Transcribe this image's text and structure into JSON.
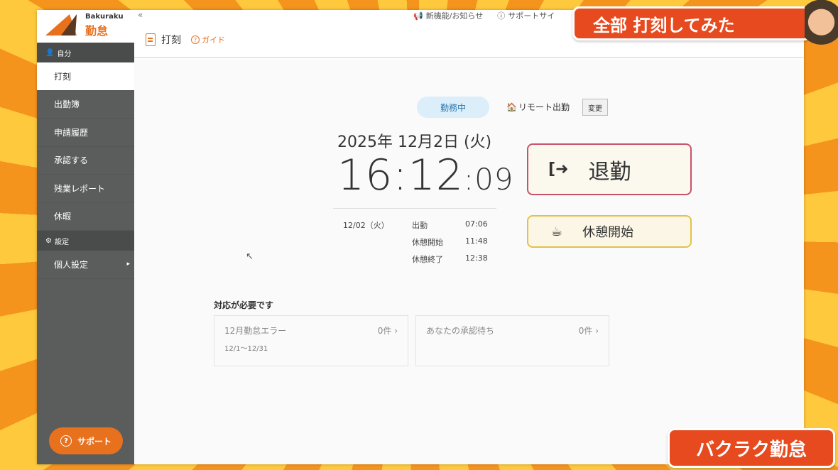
{
  "overlay": {
    "banner": "全部 打刻してみた",
    "brand_tag": "バクラク勤怠"
  },
  "logo": {
    "en": "Bakuraku",
    "jp": "勤怠"
  },
  "sidebar": {
    "section_self": "自分",
    "items": [
      {
        "label": "打刻"
      },
      {
        "label": "出勤簿"
      },
      {
        "label": "申請履歴"
      },
      {
        "label": "承認する"
      },
      {
        "label": "残業レポート"
      },
      {
        "label": "休暇"
      }
    ],
    "section_settings": "設定",
    "personal_settings": "個人設定",
    "support": "サポート"
  },
  "topbar": {
    "collapse": "«",
    "news": "新機能/お知らせ",
    "support_site": "サポートサイ"
  },
  "page": {
    "title": "打刻",
    "guide": "ガイド"
  },
  "status": {
    "working": "勤務中",
    "remote": "リモート出勤",
    "change": "変更"
  },
  "clock": {
    "date": "2025年 12月2日 (火)",
    "time": "16:12",
    "seconds": ":09"
  },
  "log": {
    "date": "12/02（火）",
    "entries": [
      {
        "label": "出勤",
        "time": "07:06"
      },
      {
        "label": "休憩開始",
        "time": "11:48"
      },
      {
        "label": "休憩終了",
        "time": "12:38"
      }
    ]
  },
  "actions": {
    "leave": "退勤",
    "break_start": "休憩開始"
  },
  "needs": {
    "title": "対応が必要です",
    "cards": [
      {
        "title": "12月勤怠エラー",
        "count": "0件",
        "sub": "12/1〜12/31"
      },
      {
        "title": "あなたの承認待ち",
        "count": "0件"
      }
    ]
  }
}
